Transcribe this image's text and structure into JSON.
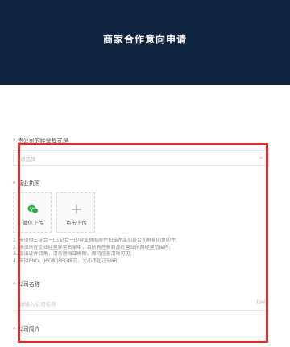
{
  "header": {
    "title": "商家合作意向申请"
  },
  "form": {
    "operation_mode": {
      "required_mark": "*",
      "label": "贵公司的经营模式是",
      "placeholder": "请选择"
    },
    "business_license": {
      "required_mark": "*",
      "label": "营业执照",
      "wechat_upload_label": "微信上传",
      "click_upload_label": "点击上传",
      "notes": [
        "1. 需提供三证合一(三证合一的营业执照原件扫描件或加盖公司鲜章的复印件;",
        "2. 确保未在企业经营异常名录中，且所有在售商品在营业执照经营范围内;",
        "3. 露出证件四角，请勿遮挡或模糊，保持信息清晰可见;",
        "4. 支持PNG、JPG和JPEG格式，大小不超过5MB;"
      ]
    },
    "company_name": {
      "required_mark": "*",
      "label": "公司名称",
      "placeholder": "请输入公司名称",
      "counter": "0/40"
    },
    "company_intro": {
      "required_mark": "*",
      "label": "公司简介"
    }
  },
  "colors": {
    "header_bg": "#0f2540",
    "highlight": "#d72f2f",
    "wechat_green": "#2bb34a"
  },
  "icons": [
    "wechat-icon",
    "plus-icon",
    "chevron-down-icon"
  ]
}
